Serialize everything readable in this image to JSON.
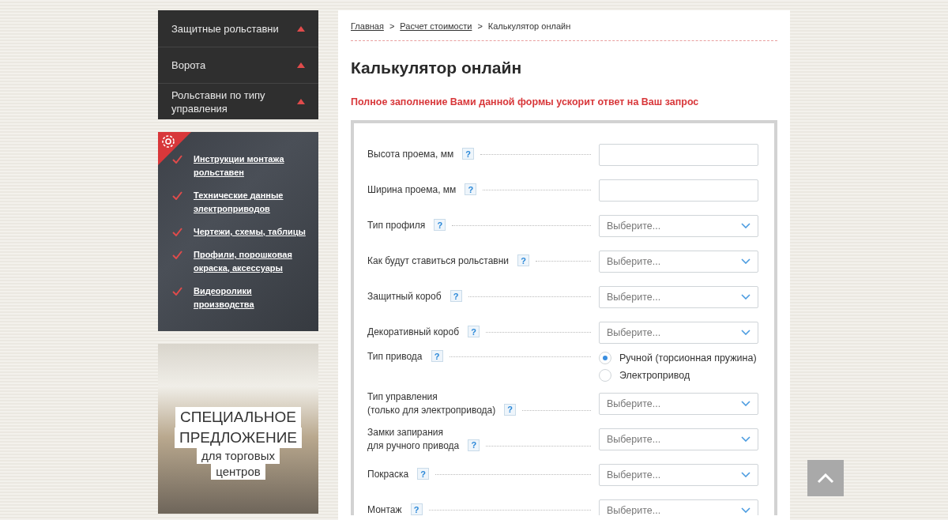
{
  "menu": [
    {
      "label": "Защитные рольставни",
      "expanded": true
    },
    {
      "label": "Ворота",
      "expanded": true
    },
    {
      "label": "Рольставни по типу управления",
      "expanded": true
    }
  ],
  "links": [
    "Инструкции монтажа рольставен",
    "Технические данные электроприводов",
    "Чертежи, схемы, таблицы",
    "Профили, порошковая окраска, аксессуары",
    "Видеоролики производства"
  ],
  "promo": {
    "lines": [
      "СПЕЦИАЛЬНОЕ",
      "ПРЕДЛОЖЕНИЕ"
    ],
    "sub_lines": [
      "для торговых",
      "центров"
    ]
  },
  "breadcrumbs": [
    {
      "label": "Главная",
      "link": true
    },
    {
      "label": "Расчет стоимости",
      "link": true
    },
    {
      "label": "Калькулятор онлайн",
      "link": false
    }
  ],
  "breadcrumb_separator": ">",
  "title": "Калькулятор онлайн",
  "notice": "Полное заполнение Вами данной формы ускорит ответ на Ваш запрос",
  "help_mark": "?",
  "fields": [
    {
      "kind": "input",
      "label": "Высота проема, мм"
    },
    {
      "kind": "input",
      "label": "Ширина проема, мм"
    },
    {
      "kind": "select",
      "label": "Тип профиля",
      "placeholder": "Выберите..."
    },
    {
      "kind": "select",
      "label": "Как будут ставиться рольставни",
      "placeholder": "Выберите..."
    },
    {
      "kind": "select",
      "label": "Защитный короб",
      "placeholder": "Выберите..."
    },
    {
      "kind": "select",
      "label": "Декоративный короб",
      "placeholder": "Выберите..."
    },
    {
      "kind": "radio",
      "label": "Тип привода",
      "options": [
        {
          "label": "Ручной (торсионная пружина)",
          "selected": true
        },
        {
          "label": "Электропривод",
          "selected": false
        }
      ]
    },
    {
      "kind": "select",
      "label": "Тип управления\n(только для электропривода)",
      "placeholder": "Выберите..."
    },
    {
      "kind": "select",
      "label": "Замки запирания\nдля ручного привода",
      "placeholder": "Выберите..."
    },
    {
      "kind": "select",
      "label": "Покраска",
      "placeholder": "Выберите..."
    },
    {
      "kind": "select",
      "label": "Монтаж",
      "placeholder": "Выберите..."
    }
  ]
}
